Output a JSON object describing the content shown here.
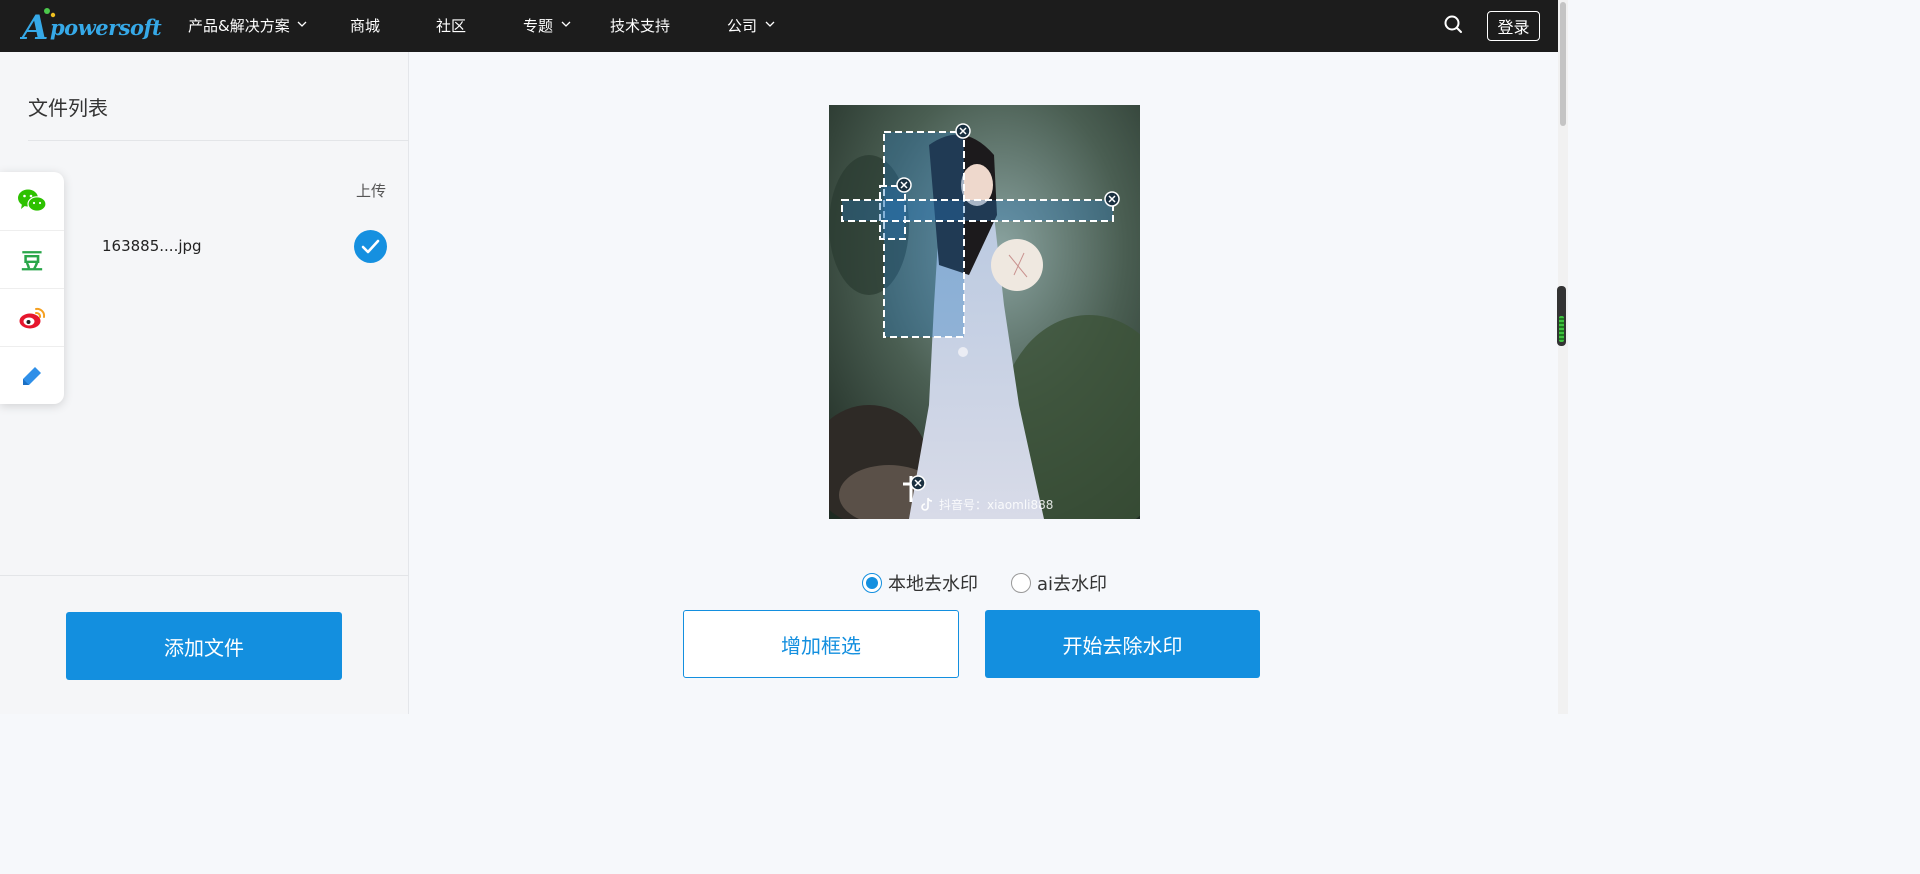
{
  "brand": {
    "name": "powersoft",
    "initial": "A"
  },
  "nav": {
    "items": [
      {
        "label": "产品&解决方案",
        "has_dropdown": true
      },
      {
        "label": "商城",
        "has_dropdown": false
      },
      {
        "label": "社区",
        "has_dropdown": false
      },
      {
        "label": "专题",
        "has_dropdown": true
      },
      {
        "label": "技术支持",
        "has_dropdown": false
      },
      {
        "label": "公司",
        "has_dropdown": true
      }
    ],
    "search_icon": "search-icon",
    "login_label": "登录"
  },
  "sidebar": {
    "title": "文件列表",
    "column_upload": "上传",
    "files": [
      {
        "name": "163885....jpg",
        "status": "uploaded"
      }
    ],
    "add_file_label": "添加文件"
  },
  "share": {
    "items": [
      {
        "name": "wechat",
        "icon": "wechat-icon"
      },
      {
        "name": "douban",
        "icon": "douban-icon",
        "glyph": "豆"
      },
      {
        "name": "weibo",
        "icon": "weibo-icon"
      },
      {
        "name": "edit",
        "icon": "pen-icon"
      }
    ]
  },
  "editor": {
    "watermark_text": "抖音号：xiaomli888",
    "selection_count": 4,
    "modes": [
      {
        "label": "本地去水印",
        "selected": true
      },
      {
        "label": "ai去水印",
        "selected": false
      }
    ],
    "add_box_label": "增加框选",
    "start_label": "开始去除水印"
  },
  "colors": {
    "accent": "#138fdf",
    "topbar": "#1c1c1c",
    "brand": "#36a9e8"
  }
}
